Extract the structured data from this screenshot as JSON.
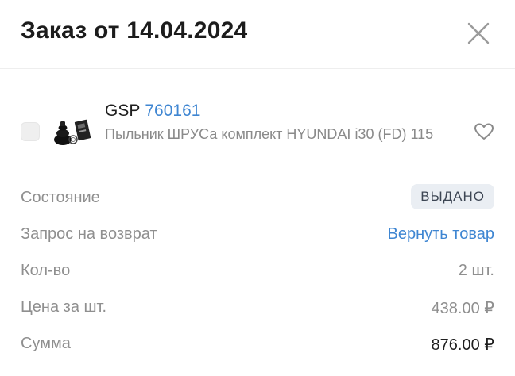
{
  "header": {
    "title": "Заказ от 14.04.2024",
    "close_icon": "close-icon"
  },
  "item": {
    "brand": "GSP",
    "code": "760161",
    "description": "Пыльник ШРУСа комплект HYUNDAI i30 (FD) 115",
    "thumbnail_icon": "cv-boot-kit-image",
    "favorite_icon": "heart-icon",
    "link_color": "#3f86d2"
  },
  "details": {
    "status_label": "Состояние",
    "status_value": "ВЫДАНО",
    "return_label": "Запрос на возврат",
    "return_action": "Вернуть товар",
    "qty_label": "Кол-во",
    "qty_value": "2 шт.",
    "price_label": "Цена за шт.",
    "price_value": "438.00 ₽",
    "sum_label": "Сумма",
    "sum_value": "876.00 ₽"
  }
}
